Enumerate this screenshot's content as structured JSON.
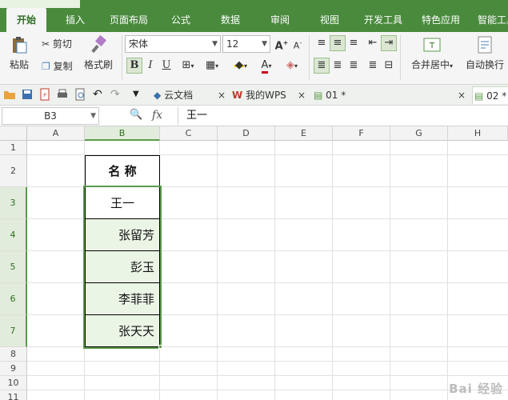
{
  "ribbon_tabs": [
    {
      "label": "开始",
      "active": true
    },
    {
      "label": "插入"
    },
    {
      "label": "页面布局"
    },
    {
      "label": "公式"
    },
    {
      "label": "数据"
    },
    {
      "label": "审阅"
    },
    {
      "label": "视图"
    },
    {
      "label": "开发工具"
    },
    {
      "label": "特色应用"
    },
    {
      "label": "智能工具"
    }
  ],
  "ribbon": {
    "paste_label": "粘贴",
    "cut_label": "剪切",
    "copy_label": "复制",
    "format_painter_label": "格式刷",
    "font_name": "宋体",
    "font_size": "12",
    "merge_label": "合并居中",
    "wrap_label": "自动换行",
    "bold": "B",
    "italic": "I",
    "underline": "U",
    "font_color_glyph": "A",
    "font_color": "#d0021b",
    "fill_color": "#f5c400"
  },
  "doc_tabs": [
    {
      "label": "云文档"
    },
    {
      "label": "我的WPS"
    },
    {
      "label": "01 *"
    },
    {
      "label": "02 *",
      "active": true
    }
  ],
  "formula_bar": {
    "name_box": "B3",
    "fx_label": "fx",
    "content": "王一"
  },
  "grid": {
    "columns": [
      "A",
      "B",
      "C",
      "D",
      "E",
      "F",
      "G",
      "H"
    ],
    "selected_column": "B",
    "rows": [
      "1",
      "2",
      "3",
      "4",
      "5",
      "6",
      "7",
      "8",
      "9",
      "10",
      "11"
    ],
    "selected_rows": [
      "3",
      "4",
      "5",
      "6",
      "7"
    ]
  },
  "table": {
    "header": "名 称",
    "names": [
      "王一",
      "张留芳",
      "彭玉",
      "李菲菲",
      "张天天"
    ]
  },
  "watermark": "Bai 经验"
}
